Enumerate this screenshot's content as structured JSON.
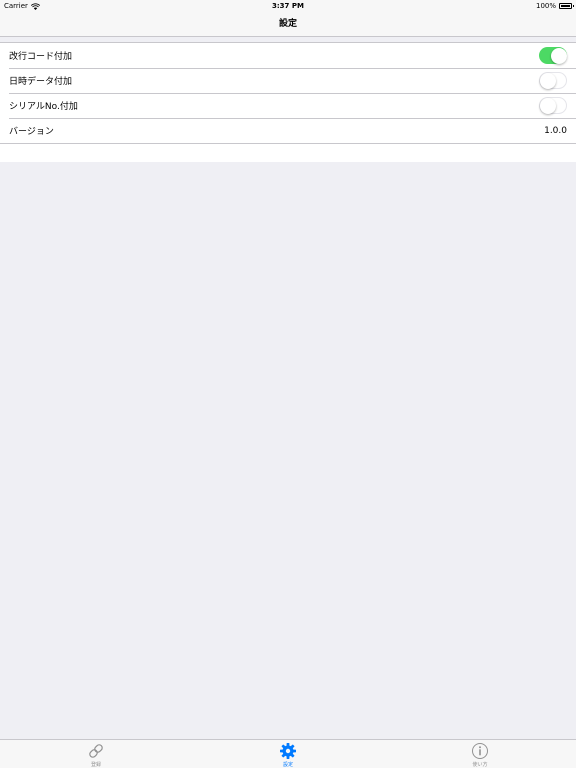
{
  "status_bar": {
    "carrier": "Carrier",
    "time": "3:37 PM",
    "battery": "100%"
  },
  "nav": {
    "title": "設定"
  },
  "settings": {
    "rows": [
      {
        "label": "改行コード付加",
        "toggle": true
      },
      {
        "label": "日時データ付加",
        "toggle": false
      },
      {
        "label": "シリアルNo.付加",
        "toggle": false
      },
      {
        "label": "バージョン",
        "value": "1.0.0"
      }
    ]
  },
  "tabs": [
    {
      "label": "登録",
      "icon": "link-icon",
      "active": false
    },
    {
      "label": "設定",
      "icon": "gear-icon",
      "active": true
    },
    {
      "label": "使い方",
      "icon": "info-icon",
      "active": false
    }
  ],
  "colors": {
    "accent": "#007aff",
    "toggle_on": "#4cd964",
    "background": "#efeff4"
  }
}
